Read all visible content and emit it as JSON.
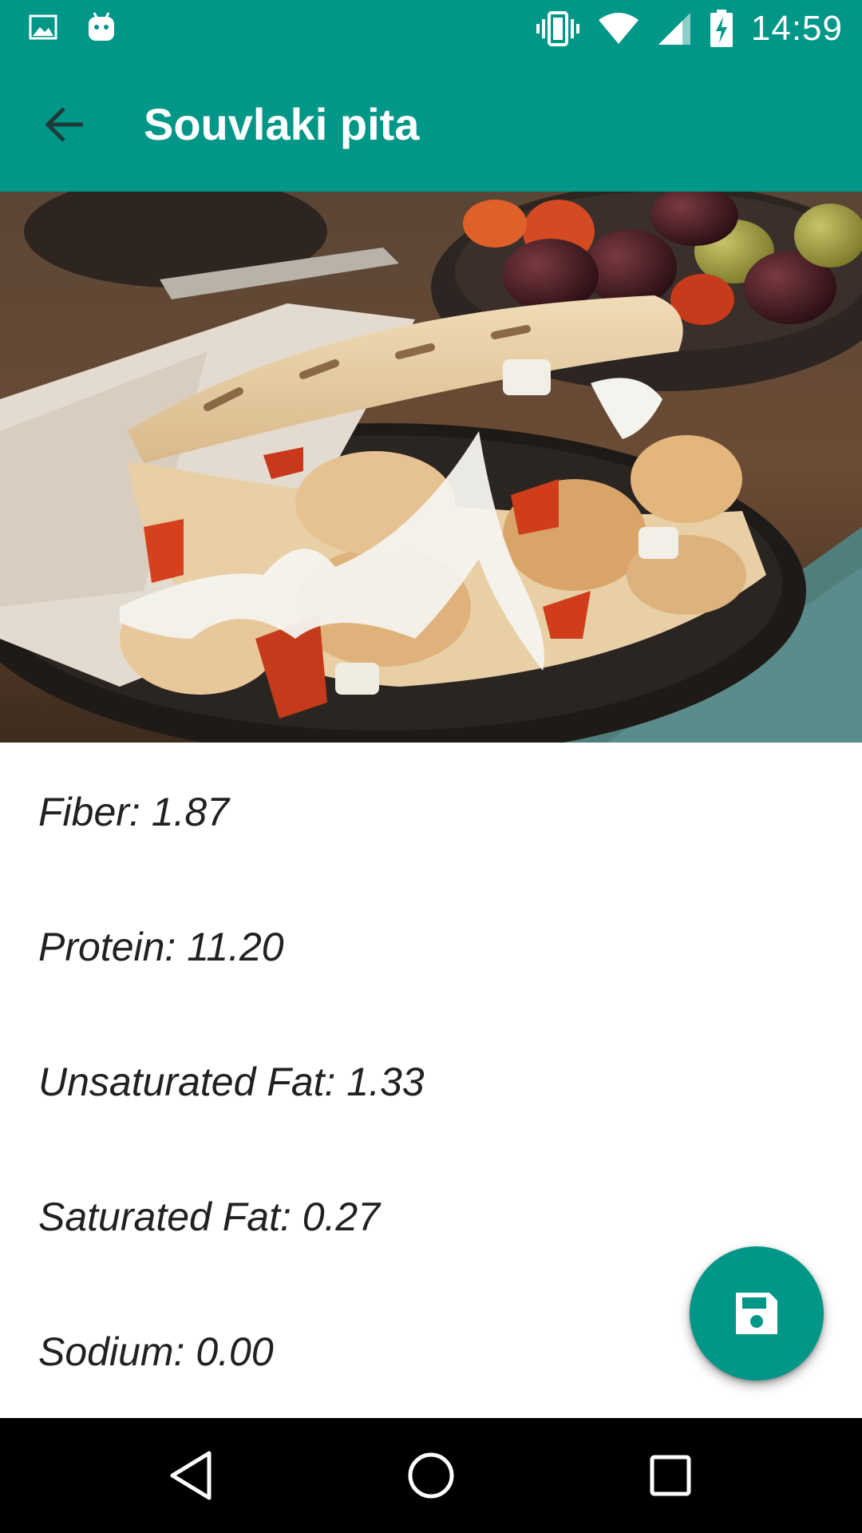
{
  "status_bar": {
    "time": "14:59",
    "icons_left": [
      "gallery-notification-icon",
      "android-notification-icon"
    ],
    "icons_right": [
      "vibrate-icon",
      "wifi-icon",
      "signal-icon",
      "battery-charging-icon"
    ]
  },
  "app_bar": {
    "title": "Souvlaki pita",
    "back_icon": "arrow-back-icon"
  },
  "hero_image": {
    "subject": "souvlaki-pita-photo"
  },
  "nutrients": [
    {
      "text": "Fiber: 1.87"
    },
    {
      "text": "Protein: 11.20"
    },
    {
      "text": "Unsaturated Fat: 1.33"
    },
    {
      "text": "Saturated Fat: 0.27"
    },
    {
      "text": "Sodium: 0.00"
    }
  ],
  "fab": {
    "icon": "save-icon"
  },
  "nav_bar": {
    "buttons": [
      "back-triangle-icon",
      "home-circle-icon",
      "recents-square-icon"
    ]
  },
  "colors": {
    "primary": "#009688",
    "text": "#212121",
    "nav_background": "#000000"
  }
}
